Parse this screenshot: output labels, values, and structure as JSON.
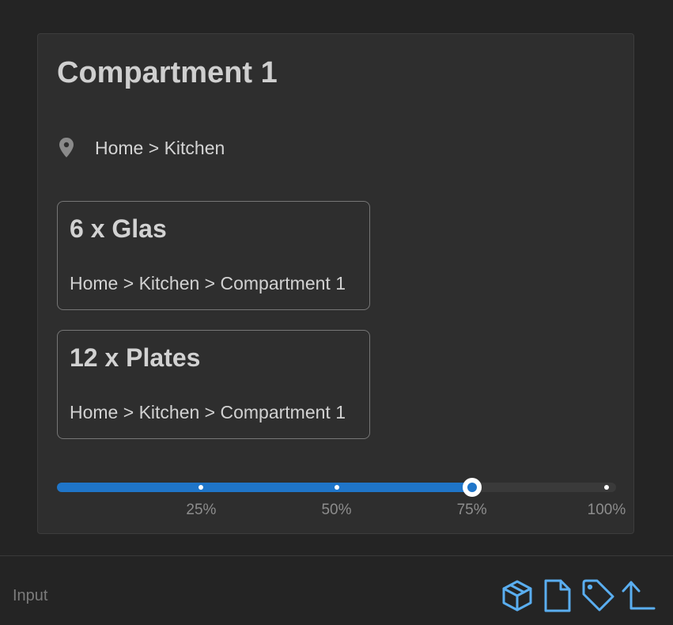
{
  "card": {
    "title": "Compartment 1",
    "location_icon": "map-pin-icon",
    "location": "Home > Kitchen"
  },
  "items": [
    {
      "title": "6 x Glas",
      "path": "Home > Kitchen > Compartment 1"
    },
    {
      "title": "12 x Plates",
      "path": "Home > Kitchen > Compartment 1"
    }
  ],
  "slider": {
    "value_percent": 75,
    "marks": [
      "25%",
      "50%",
      "75%",
      "100%"
    ],
    "accent": "#1f75c9"
  },
  "footer": {
    "input_label": "Input",
    "icons": [
      "package-icon",
      "file-icon",
      "tag-icon",
      "corner-left-up-icon"
    ],
    "icon_color": "#5aaef0"
  }
}
